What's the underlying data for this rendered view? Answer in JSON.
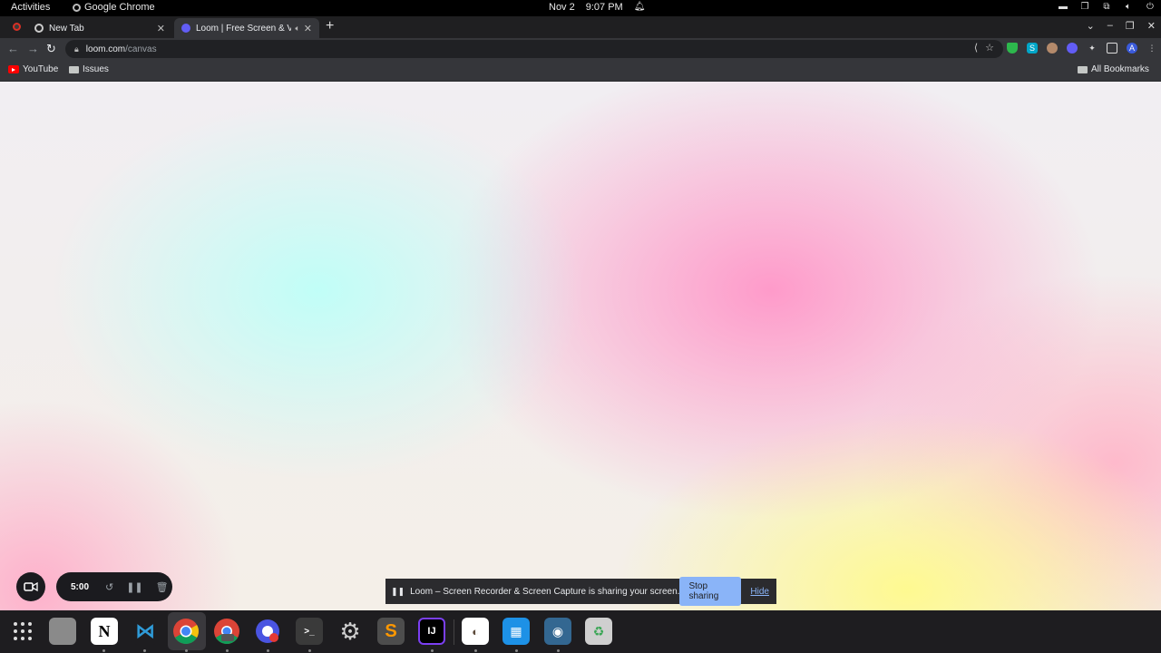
{
  "system": {
    "activities": "Activities",
    "app_name": "Google Chrome",
    "date": "Nov 2",
    "time": "9:07 PM"
  },
  "tabs": [
    {
      "label": "New Tab"
    },
    {
      "label": "Loom | Free Screen & Vi"
    }
  ],
  "omnibox": {
    "host": "loom.com",
    "path": "/canvas"
  },
  "bookmarks": {
    "items": [
      {
        "label": "YouTube"
      },
      {
        "label": "Issues"
      }
    ],
    "all": "All Bookmarks"
  },
  "loom": {
    "timer": "5:00"
  },
  "sharebar": {
    "message": "Loom – Screen Recorder & Screen Capture is sharing your screen.",
    "stop": "Stop sharing",
    "hide": "Hide"
  },
  "dock": {
    "apps": [
      "apps-grid",
      "files",
      "notion",
      "vscode",
      "chrome",
      "chrome-beta",
      "recorder",
      "terminal",
      "settings",
      "sublime-text",
      "intellij",
      "gimp",
      "docker",
      "postgresql",
      "trash"
    ]
  },
  "colors": {
    "accent": "#8ab4f8",
    "record": "#d93025"
  }
}
